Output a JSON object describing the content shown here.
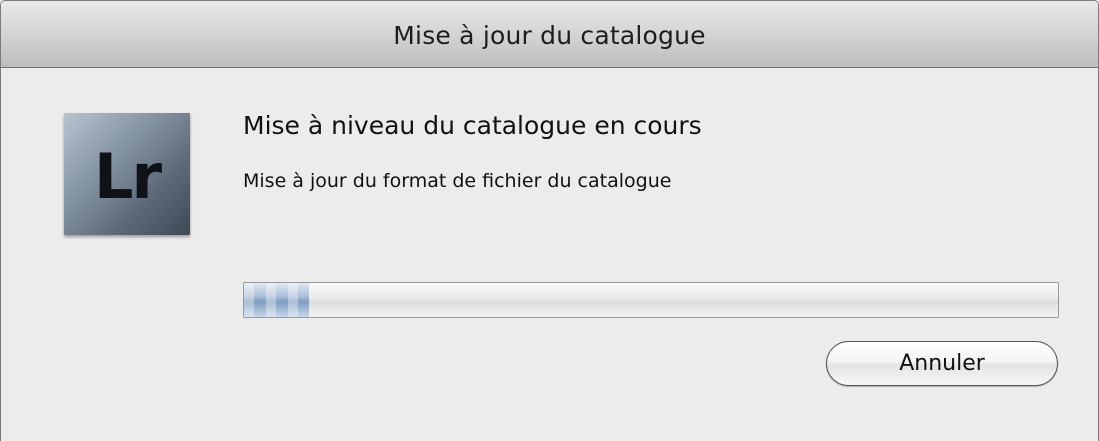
{
  "window": {
    "title": "Mise à jour du catalogue"
  },
  "app_icon": {
    "label": "Lr",
    "icon": "lightroom-app-icon"
  },
  "dialog": {
    "heading": "Mise à niveau du catalogue en cours",
    "message": "Mise à jour du format de fichier du catalogue"
  },
  "progress": {
    "fraction": 0.08
  },
  "buttons": {
    "cancel_label": "Annuler"
  },
  "colors": {
    "window_bg": "#ececec",
    "progress_fill": "#7f9cc0"
  }
}
